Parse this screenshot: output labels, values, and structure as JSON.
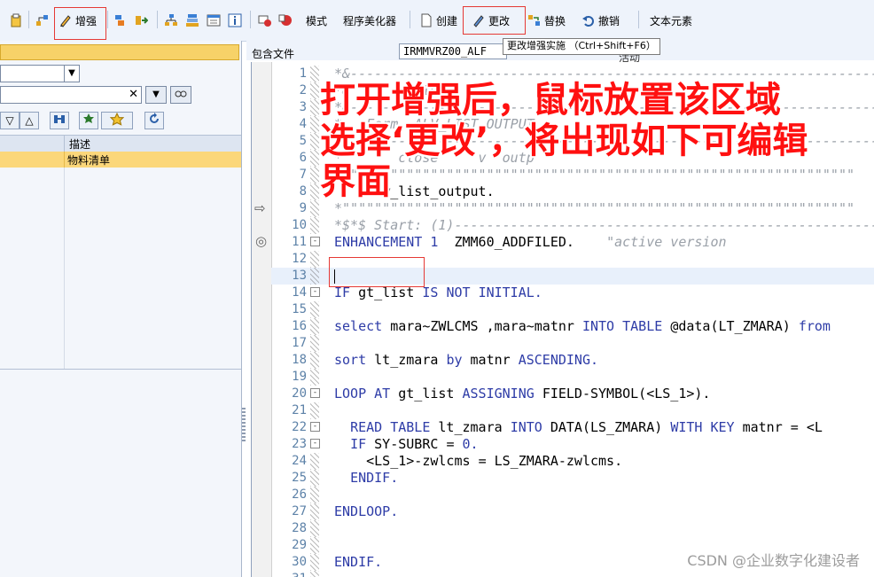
{
  "toolbar": {
    "enhance_label": "增强",
    "mode_label": "模式",
    "pretty_printer_label": "程序美化器",
    "create_label": "创建",
    "change_label": "更改",
    "replace_label": "替换",
    "undo_label": "撤销",
    "text_elements_label": "文本元素"
  },
  "tooltip": "更改增强实施 （Ctrl+Shift+F6）",
  "left_panel": {
    "table_header_desc": "描述",
    "row_desc": "物料清单"
  },
  "info_bar": {
    "include_label": "包含文件",
    "include_value": "IRMMVRZ00_ALF",
    "extra_text": "活动"
  },
  "editor": {
    "lines": [
      {
        "n": "1",
        "text": "*&---------------------------------------------------------------------"
      },
      {
        "n": "2",
        "text": "*&         IRM"
      },
      {
        "n": "3",
        "text": "*&---------------------------------------------------------------------"
      },
      {
        "n": "4",
        "text": "*   Form  ALV_LIST_OUTPUT"
      },
      {
        "n": "5",
        "text": "*----------------------------------------------------------------------"
      },
      {
        "n": "6",
        "text": "*       close     v  outp"
      },
      {
        "n": "7",
        "text": "*\"\"\"\"\"\"\"\"\"\"\"\"\"\"\"\"\"\"\"\"\"\"\"\"\"\"\"\"\"\"\"\"\"\"\"\"\"\"\"\"\"\"\"\"\"\"\"\"\"\"\"\"\"\"\"\"\"\"\"\"\"\"\"\""
      },
      {
        "n": "8",
        "text": "      w_list_output."
      },
      {
        "n": "9",
        "text": "*\"\"\"\"\"\"\"\"\"\"\"\"\"\"\"\"\"\"\"\"\"\"\"\"\"\"\"\"\"\"\"\"\"\"\"\"\"\"\"\"\"\"\"\"\"\"\"\"\"\"\"\"\"\"\"\"\"\"\"\"\"\"\"\""
      },
      {
        "n": "10",
        "text": "*$*$ Start: (1)---------------------------------------------------------"
      },
      {
        "n": "11",
        "text": "ENHANCEMENT 1  ZMM60_ADDFILED.    \"active version"
      },
      {
        "n": "12",
        "text": ""
      },
      {
        "n": "13",
        "text": ""
      },
      {
        "n": "14",
        "text": "IF gt_list IS NOT INITIAL."
      },
      {
        "n": "15",
        "text": ""
      },
      {
        "n": "16",
        "text": "select mara~ZWLCMS ,mara~matnr INTO TABLE @data(LT_ZMARA) from"
      },
      {
        "n": "17",
        "text": ""
      },
      {
        "n": "18",
        "text": "sort lt_zmara by matnr ASCENDING."
      },
      {
        "n": "19",
        "text": ""
      },
      {
        "n": "20",
        "text": "LOOP AT gt_list ASSIGNING FIELD-SYMBOL(<LS_1>)."
      },
      {
        "n": "21",
        "text": ""
      },
      {
        "n": "22",
        "text": "  READ TABLE lt_zmara INTO DATA(LS_ZMARA) WITH KEY matnr = <L"
      },
      {
        "n": "23",
        "text": "  IF SY-SUBRC = 0."
      },
      {
        "n": "24",
        "text": "    <LS_1>-zwlcms = LS_ZMARA-zwlcms."
      },
      {
        "n": "25",
        "text": "  ENDIF."
      },
      {
        "n": "26",
        "text": ""
      },
      {
        "n": "27",
        "text": "ENDLOOP."
      },
      {
        "n": "28",
        "text": ""
      },
      {
        "n": "29",
        "text": ""
      },
      {
        "n": "30",
        "text": "ENDIF."
      },
      {
        "n": "31",
        "text": ""
      }
    ]
  },
  "annotation": {
    "line1": "打开增强后，鼠标放置该区域",
    "line2": "选择‘更改’，将出现如下可编辑",
    "line3": "界面"
  },
  "watermark": "CSDN @企业数字化建设者",
  "colors": {
    "keyword": "#2e3ca7",
    "comment": "#9aa0a8",
    "annotation": "#ff1010",
    "highlight_row": "#fbd77a"
  }
}
